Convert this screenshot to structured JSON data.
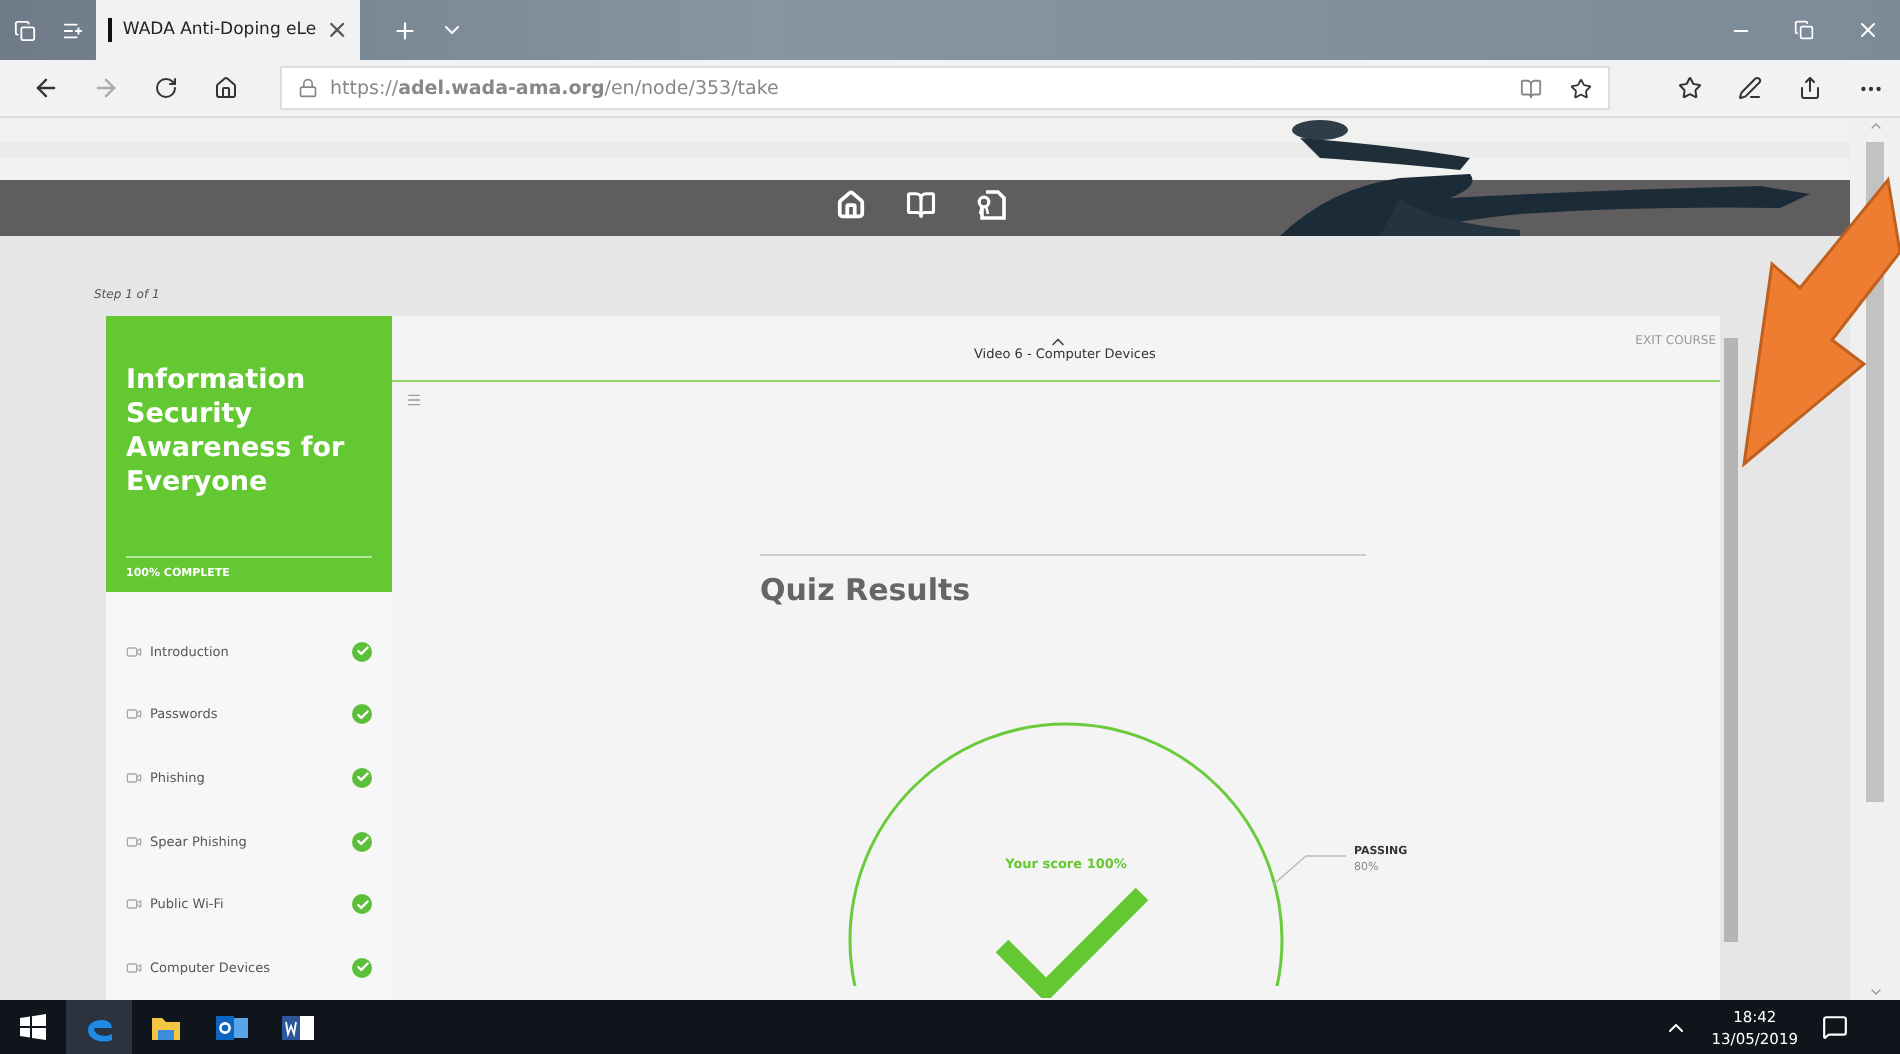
{
  "browser": {
    "tabs": [
      {
        "title": "WADA Anti-Doping eLe",
        "selected": true
      }
    ],
    "tab_close": "×",
    "url": "https://**adel.wada-ama.org**/en/node/353/take"
  },
  "course": {
    "step": "Step 1 of 1",
    "title": "Information Security Awareness for Everyone",
    "progress": "100% COMPLETE",
    "current_lesson": "Video 6 - Computer Devices",
    "exit": "EXIT COURSE",
    "lessons": [
      {
        "label": "Introduction",
        "completed": true
      },
      {
        "label": "Passwords",
        "completed": true
      },
      {
        "label": "Phishing",
        "completed": true
      },
      {
        "label": "Spear Phishing",
        "completed": true
      },
      {
        "label": "Public Wi-Fi",
        "completed": true
      },
      {
        "label": "Computer Devices",
        "completed": true
      }
    ]
  },
  "quiz": {
    "title": "Quiz Results",
    "score": "Your score 100%",
    "passed": true,
    "passing_label": "PASSING",
    "passing_value": "80%"
  },
  "taskbar": {
    "apps": [
      {
        "kind": "edge",
        "selected": true
      },
      {
        "kind": "explorer",
        "selected": false
      },
      {
        "kind": "outlook",
        "selected": false
      },
      {
        "kind": "word",
        "selected": false
      }
    ],
    "time": "18:42",
    "date": "13/05/2019"
  }
}
